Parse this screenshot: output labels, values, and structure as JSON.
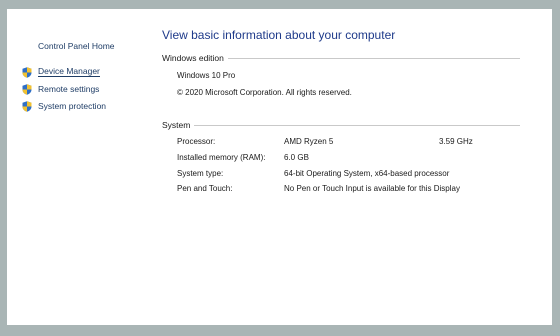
{
  "nav": {
    "home": "Control Panel Home",
    "items": [
      {
        "label": "Device Manager",
        "icon": "shield-icon"
      },
      {
        "label": "Remote settings",
        "icon": "shield-icon"
      },
      {
        "label": "System protection",
        "icon": "shield-icon"
      }
    ]
  },
  "main": {
    "title": "View basic information about your computer",
    "windows_edition": {
      "heading": "Windows edition",
      "edition": "Windows 10 Pro",
      "copyright": "© 2020 Microsoft Corporation. All rights reserved."
    },
    "system": {
      "heading": "System",
      "rows": [
        {
          "label": "Processor:",
          "value": "AMD Ryzen 5",
          "extra": "3.59 GHz"
        },
        {
          "label": "Installed memory (RAM):",
          "value": "6.0 GB",
          "extra": ""
        },
        {
          "label": "System type:",
          "value": "64-bit Operating System, x64-based processor",
          "extra": ""
        },
        {
          "label": "Pen and Touch:",
          "value": "No Pen or Touch Input is available for this Display",
          "extra": ""
        }
      ]
    }
  },
  "colors": {
    "link": "#1f3d66",
    "title": "#1e3a8a",
    "shield_blue": "#2f6fc6",
    "shield_yellow": "#f2c230"
  }
}
